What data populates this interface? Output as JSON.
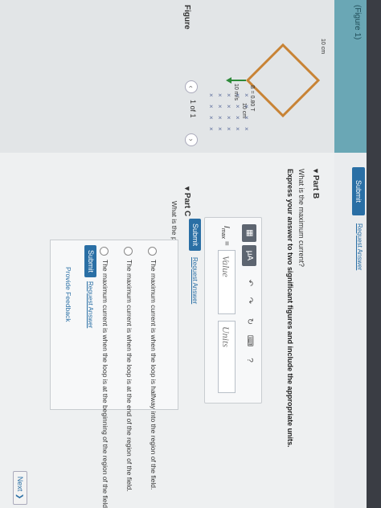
{
  "figure_link": "(Figure 1)",
  "figure": {
    "title": "Figure",
    "pager": "1 of 1",
    "prev_icon": "chevron-left-icon",
    "next_icon": "chevron-right-icon",
    "label_side_top": "10 cm",
    "label_side_bottom": "10 cm",
    "label_velocity": "10 m/s",
    "label_field": "B = 0.80 T",
    "field_marks": "×",
    "loop_color": "#c88335",
    "arrow_color": "#2e8a3a"
  },
  "part_a": {
    "submit": "Submit",
    "request": "Request Answer"
  },
  "part_b": {
    "header": "Part B",
    "question": "What is the maximum current?",
    "instruction": "Express your answer to two significant figures and include the appropriate units.",
    "toolbar": {
      "templates_icon": "matrix-templates-icon",
      "units_button": "μA",
      "undo_icon": "undo-icon",
      "redo_icon": "redo-icon",
      "reset_icon": "reset-icon",
      "keyboard_icon": "keyboard-icon",
      "help": "?"
    },
    "variable": "I",
    "variable_sub": "max",
    "equals": "=",
    "value_placeholder": "Value",
    "units_placeholder": "Units",
    "submit": "Submit",
    "request": "Request Answer"
  },
  "part_c": {
    "header": "Part C",
    "question": "What is the position of the loop when the current is maximum?",
    "options": [
      "The maximum current is when the loop is halfway into the region of the field.",
      "The maximum current is when the loop is at the end of the region of the field.",
      "The maximum current is when the loop is at the beginning of the region of the field."
    ],
    "submit": "Submit",
    "request": "Request Answer"
  },
  "feedback": "Provide Feedback",
  "next": "Next ❯"
}
